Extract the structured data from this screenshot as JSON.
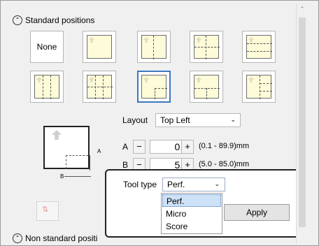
{
  "standard_positions": {
    "title": "Standard positions",
    "toggle_icon": "chevron-up-icon",
    "tiles": [
      {
        "label": "None"
      },
      {
        "label": ""
      },
      {
        "label": ""
      },
      {
        "label": ""
      },
      {
        "label": ""
      },
      {
        "label": ""
      },
      {
        "label": ""
      },
      {
        "label": ""
      },
      {
        "label": ""
      },
      {
        "label": ""
      }
    ],
    "selected_tile_index": 7
  },
  "layout": {
    "label": "Layout",
    "value": "Top Left"
  },
  "param_a": {
    "label": "A",
    "minus": "−",
    "value": "0.1",
    "plus": "+",
    "range": "(0.1 - 89.9)mm"
  },
  "param_b": {
    "label": "B",
    "minus": "−",
    "value": "5.0",
    "plus": "+",
    "range": "(5.0 - 85.0)mm"
  },
  "diagram": {
    "label_a": "A",
    "label_b": "B"
  },
  "tool_popup": {
    "tool_type_label": "Tool type",
    "tool_type_value": "Perf.",
    "options": [
      "Perf.",
      "Micro",
      "Score"
    ],
    "highlighted_option": "Perf.",
    "apply_label": "Apply"
  },
  "non_standard": {
    "title": "Non standard positi"
  }
}
